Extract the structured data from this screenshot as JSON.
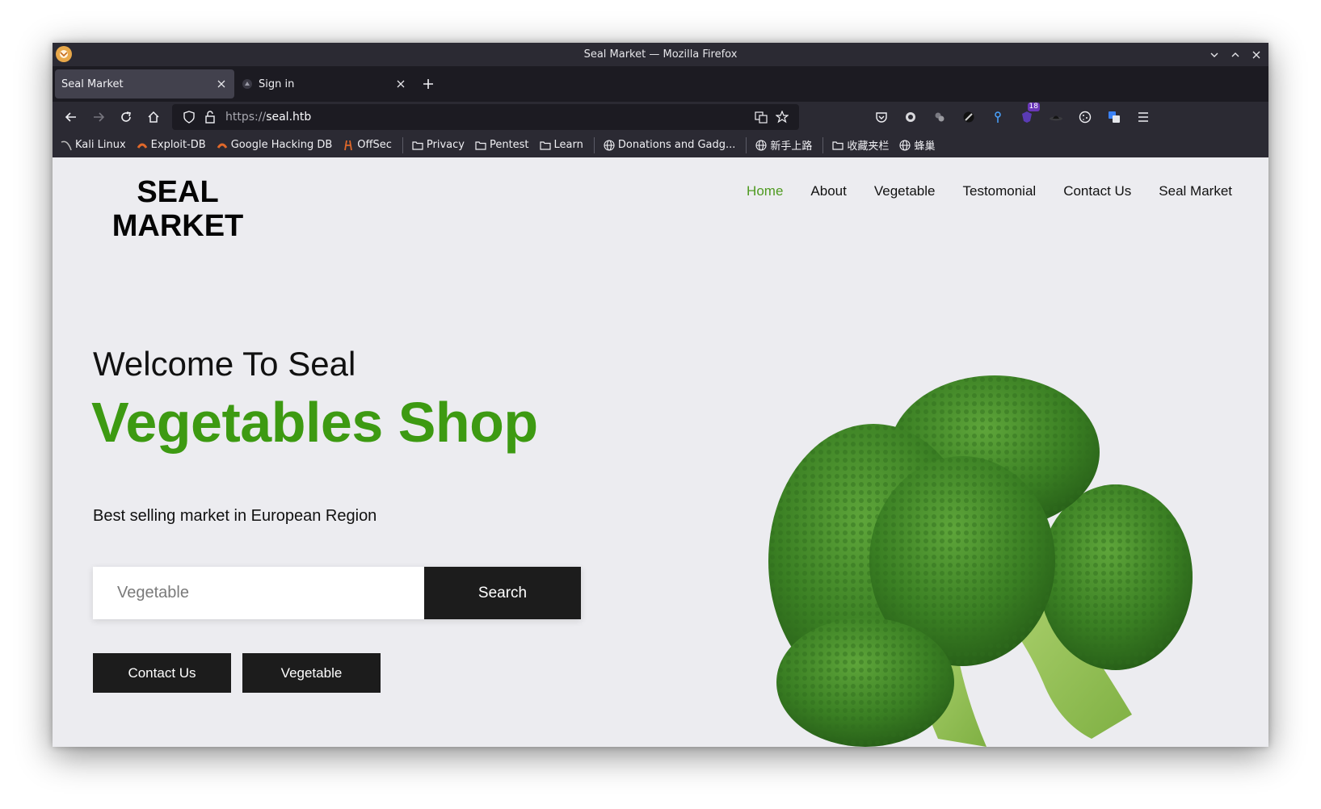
{
  "window": {
    "title": "Seal Market — Mozilla Firefox"
  },
  "tabs": [
    {
      "label": "Seal Market",
      "active": true
    },
    {
      "label": "Sign in",
      "active": false
    }
  ],
  "urlbar": {
    "scheme": "https://",
    "host": "seal.htb"
  },
  "extensions": {
    "badge_count": "18"
  },
  "bookmarks": [
    {
      "label": "Kali Linux",
      "icon": "kali-dragon-icon"
    },
    {
      "label": "Exploit-DB",
      "icon": "exploit-db-icon"
    },
    {
      "label": "Google Hacking DB",
      "icon": "ghdb-icon"
    },
    {
      "label": "OffSec",
      "icon": "offsec-icon"
    },
    {
      "label": "Privacy",
      "icon": "folder-icon"
    },
    {
      "label": "Pentest",
      "icon": "folder-icon"
    },
    {
      "label": "Learn",
      "icon": "folder-icon"
    },
    {
      "label": "Donations and Gadg...",
      "icon": "globe-icon"
    },
    {
      "label": "新手上路",
      "icon": "globe-icon"
    },
    {
      "label": "收藏夹栏",
      "icon": "folder-icon"
    },
    {
      "label": "蜂巢",
      "icon": "globe-icon"
    }
  ],
  "site": {
    "logo_line1": "SEAL",
    "logo_line2": "MARKET",
    "nav": [
      "Home",
      "About",
      "Vegetable",
      "Testomonial",
      "Contact Us",
      "Seal Market"
    ],
    "hero_subtitle": "Welcome To Seal",
    "hero_title": "Vegetables Shop",
    "hero_description": "Best selling market in European Region",
    "search_placeholder": "Vegetable",
    "search_button": "Search",
    "contact_button": "Contact Us",
    "vegetable_button": "Vegetable"
  },
  "colors": {
    "accent_green": "#3d9a12",
    "nav_active": "#4f9a21",
    "dark_button": "#1c1c1c",
    "page_bg": "#ececf0",
    "browser_chrome": "#2b2a33"
  }
}
